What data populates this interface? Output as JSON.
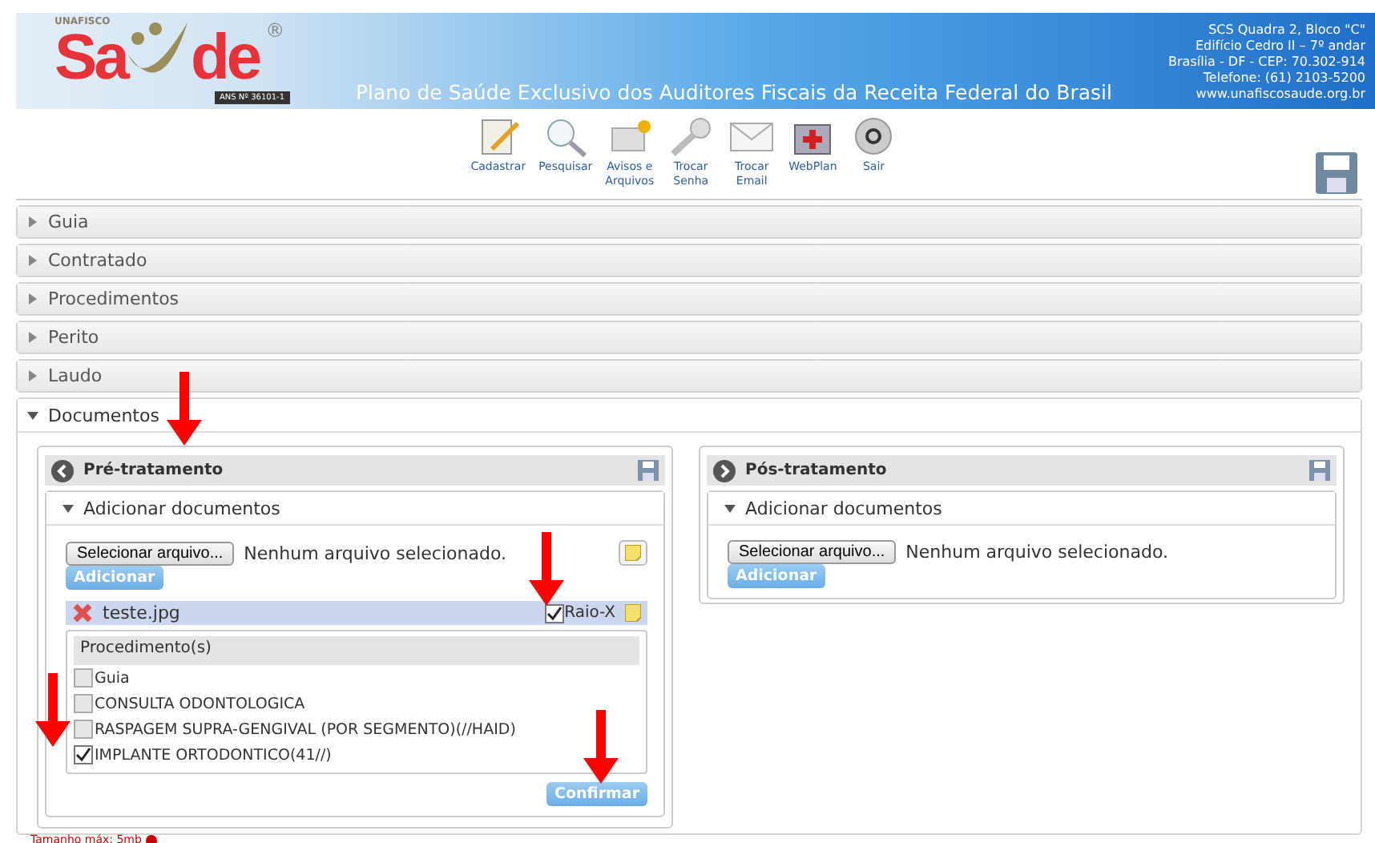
{
  "header": {
    "brand_small": "UNAFISCO",
    "brand_left": "Sa",
    "brand_right": "de",
    "registered": "®",
    "ans": "ANS Nº 36101-1",
    "tagline": "Plano de Saúde Exclusivo dos Auditores Fiscais da Receita Federal do Brasil",
    "address": [
      "SCS Quadra 2, Bloco \"C\"",
      "Edifício Cedro II – 7º andar",
      "Brasília - DF - CEP: 70.302-914",
      "Telefone: (61) 2103-5200",
      "www.unafiscosaude.org.br"
    ]
  },
  "toolbar": [
    {
      "kind": "edit",
      "label": [
        "Cadastrar"
      ]
    },
    {
      "kind": "search",
      "label": [
        "Pesquisar"
      ]
    },
    {
      "kind": "notice",
      "label": [
        "Avisos e",
        "Arquivos"
      ]
    },
    {
      "kind": "key",
      "label": [
        "Trocar",
        "Senha"
      ]
    },
    {
      "kind": "mail",
      "label": [
        "Trocar",
        "Email"
      ]
    },
    {
      "kind": "kit",
      "label": [
        "WebPlan"
      ]
    },
    {
      "kind": "power",
      "label": [
        "Sair"
      ]
    }
  ],
  "sections": [
    {
      "title": "Guia",
      "expanded": false
    },
    {
      "title": "Contratado",
      "expanded": false
    },
    {
      "title": "Procedimentos",
      "expanded": false
    },
    {
      "title": "Perito",
      "expanded": false
    },
    {
      "title": "Laudo",
      "expanded": false
    },
    {
      "title": "Documentos",
      "expanded": true
    }
  ],
  "panels": [
    {
      "kind": "back",
      "title": "Pré-tratamento",
      "sub_title": "Adicionar documentos",
      "sub_expanded": true,
      "file_button": "Selecionar arquivo...",
      "file_status": "Nenhum arquivo selecionado.",
      "add_button": "Adicionar",
      "note_icon": true,
      "attachments": [
        {
          "name": "teste.jpg",
          "checked": true,
          "type_label": "Raio-X"
        }
      ],
      "procedures": {
        "title": "Procedimento(s)",
        "items": [
          {
            "label": "Guia",
            "checked": false
          },
          {
            "label": "CONSULTA ODONTOLOGICA",
            "checked": false
          },
          {
            "label": "RASPAGEM SUPRA-GENGIVAL (POR SEGMENTO)(//HAID)",
            "checked": false
          },
          {
            "label": "IMPLANTE ORTODONTICO(41//)",
            "checked": true
          }
        ]
      },
      "confirm_button": "Confirmar"
    },
    {
      "kind": "forward",
      "title": "Pós-tratamento",
      "sub_title": "Adicionar documentos",
      "sub_expanded": true,
      "file_button": "Selecionar arquivo...",
      "file_status": "Nenhum arquivo selecionado.",
      "add_button": "Adicionar",
      "note_icon": false
    }
  ],
  "footer_note": "Tamanho máx: 5mb"
}
